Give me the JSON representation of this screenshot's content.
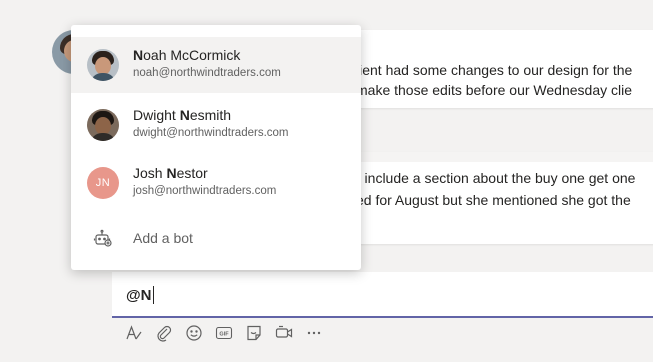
{
  "mention_suggestions": [
    {
      "name_bold": "N",
      "name_rest": "oah McCormick",
      "name_prefix": "",
      "email": "noah@northwindtraders.com",
      "selected": true
    },
    {
      "name_prefix": "Dwight ",
      "name_bold": "N",
      "name_rest": "esmith",
      "email": "dwight@northwindtraders.com",
      "selected": false
    },
    {
      "name_prefix": "Josh ",
      "name_bold": "N",
      "name_rest": "estor",
      "email": "josh@northwindtraders.com",
      "initials": "JN",
      "selected": false
    }
  ],
  "add_bot_label": "Add a bot",
  "messages": [
    {
      "lines": [
        "lient had some changes to our design for the",
        "make those edits before our Wednesday clie"
      ]
    },
    {
      "lines": [
        ") include a section about the buy one get one",
        "ed for August but she mentioned she got the"
      ]
    }
  ],
  "compose": {
    "text": "@N"
  },
  "toolbar_icons": [
    "format-icon",
    "attach-icon",
    "emoji-icon",
    "gif-icon",
    "sticker-icon",
    "meet-now-icon",
    "more-options-icon"
  ],
  "colors": {
    "accent": "#6264a7",
    "josh_avatar": "#e8978b",
    "background": "#f3f2f1"
  }
}
